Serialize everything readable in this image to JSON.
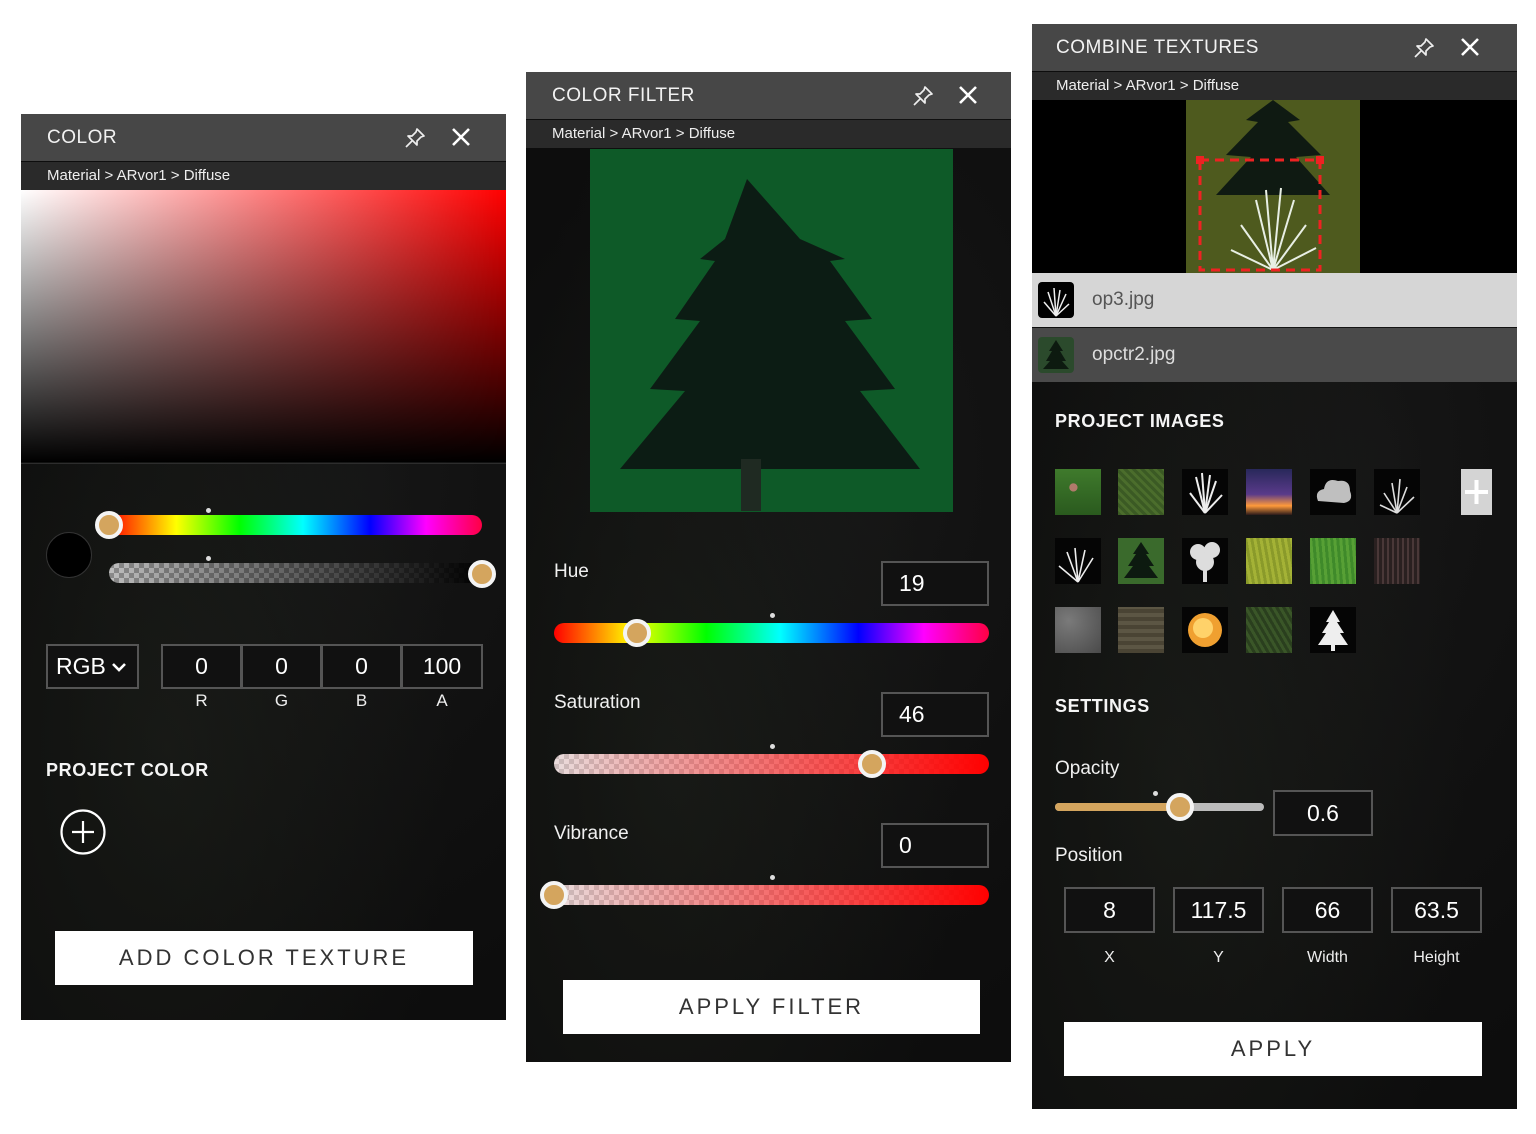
{
  "color_panel": {
    "title": "COLOR",
    "breadcrumb": "Material > ARvor1 > Diffuse",
    "mode": "RGB",
    "channels": [
      {
        "value": "0",
        "label": "R"
      },
      {
        "value": "0",
        "label": "G"
      },
      {
        "value": "0",
        "label": "B"
      },
      {
        "value": "100",
        "label": "A"
      }
    ],
    "hue_level": 0.0,
    "alpha_level": 1.0,
    "swatch_color": "#000000",
    "project_color_title": "PROJECT COLOR",
    "add_button": "ADD COLOR TEXTURE"
  },
  "filter_panel": {
    "title": "COLOR FILTER",
    "breadcrumb": "Material > ARvor1 > Diffuse",
    "preview_background": "#0e5a28",
    "hue": {
      "label": "Hue",
      "value": "19"
    },
    "saturation": {
      "label": "Saturation",
      "value": "46"
    },
    "vibrance": {
      "label": "Vibrance",
      "value": "0"
    },
    "apply_button": "APPLY FILTER"
  },
  "combine_panel": {
    "title": "COMBINE TEXTURES",
    "breadcrumb": "Material > ARvor1 > Diffuse",
    "layers": [
      {
        "name": "op3.jpg",
        "selected": true
      },
      {
        "name": "opctr2.jpg",
        "selected": false
      }
    ],
    "project_images_title": "PROJECT IMAGES",
    "project_images": [
      "flowers-image",
      "grass-image",
      "white-grass-image",
      "sunset-image",
      "cloud-image",
      "white-spikes-image",
      "white-grass-2-image",
      "tree-image",
      "white-tree-image",
      "yellow-grass-image",
      "green-grass-image",
      "bark-image",
      "concrete-image",
      "dirt-image",
      "sun-image",
      "fern-image",
      "white-pine-image"
    ],
    "settings_title": "SETTINGS",
    "opacity": {
      "label": "Opacity",
      "value": "0.6"
    },
    "position_label": "Position",
    "position": [
      {
        "value": "8",
        "label": "X"
      },
      {
        "value": "117.5",
        "label": "Y"
      },
      {
        "value": "66",
        "label": "Width"
      },
      {
        "value": "63.5",
        "label": "Height"
      }
    ],
    "apply_button": "APPLY"
  },
  "colors": {
    "accent_knob": "#d4a55e",
    "titlebar": "#474747",
    "selected_layer": "#d6d6d6"
  }
}
